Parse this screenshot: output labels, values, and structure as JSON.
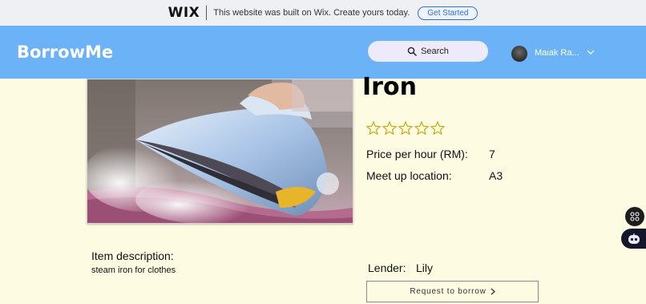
{
  "wix_banner": {
    "logo": "WIX",
    "message": "This website was built on Wix. Create yours today.",
    "cta_label": "Get Started"
  },
  "header": {
    "brand": "BorrowMe",
    "search_label": "Search",
    "user_name": "Maiak Ra...",
    "colors": {
      "header_bg": "#6bb2f7",
      "page_bg": "#fefbe3",
      "search_bg": "#edeaf9"
    }
  },
  "product": {
    "image_icon": "steam-iron-photo",
    "title": "Iron",
    "rating": {
      "filled": 0,
      "max": 5,
      "star_color": "#c9a300"
    },
    "price_label": "Price per hour (RM):",
    "price_value": "7",
    "location_label": "Meet up location:",
    "location_value": "A3",
    "description_label": "Item description:",
    "description": "steam iron for clothes",
    "lender_label": "Lender:",
    "lender_name": "Lily",
    "request_button": "Request to borrow"
  },
  "widgets": {
    "apps_icon": "grid-icon",
    "chat_icon": "robot-chat-icon"
  }
}
